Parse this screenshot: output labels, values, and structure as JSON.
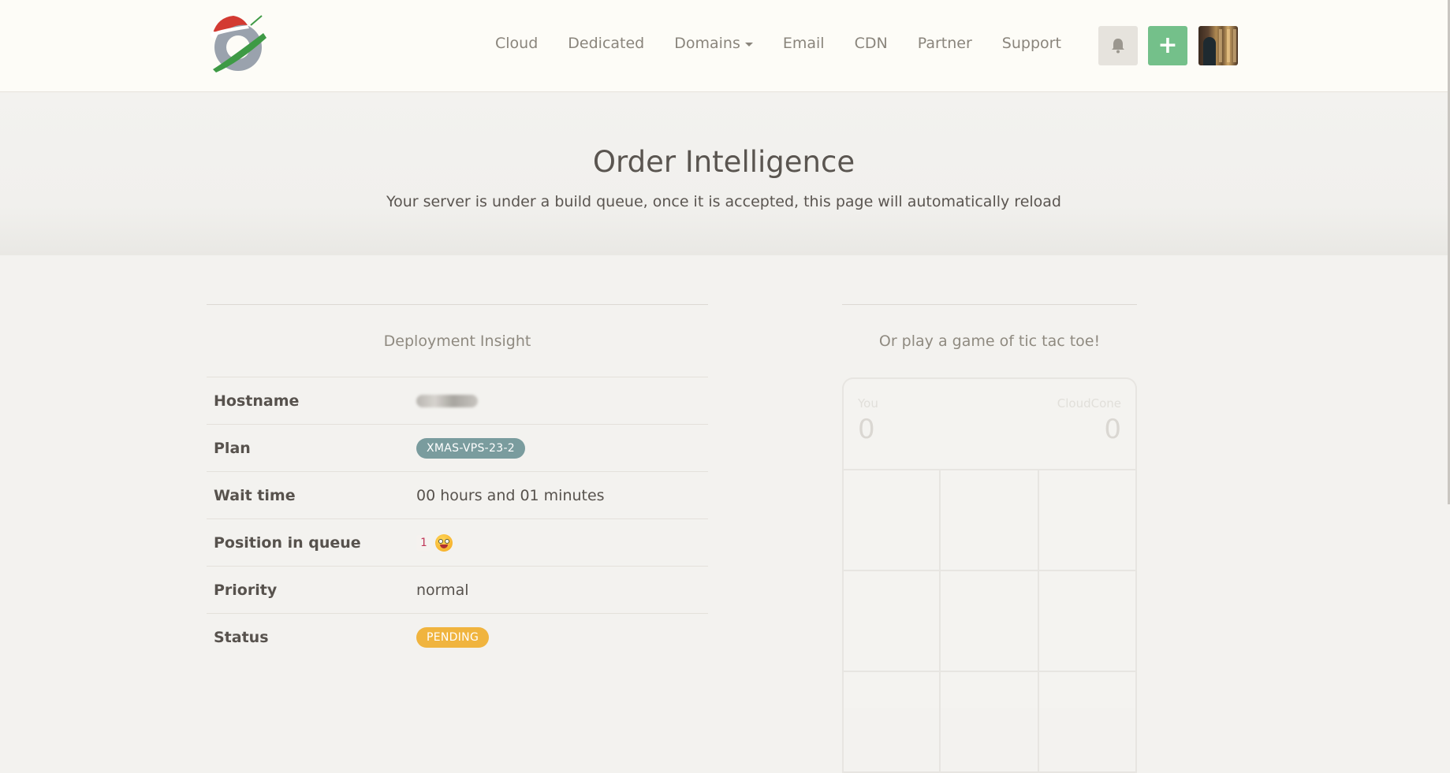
{
  "navbar": {
    "logo_icon": "cloudcone-logo-icon",
    "links": [
      {
        "label": "Cloud"
      },
      {
        "label": "Dedicated"
      },
      {
        "label": "Domains",
        "dropdown": true
      },
      {
        "label": "Email"
      },
      {
        "label": "CDN"
      },
      {
        "label": "Partner"
      },
      {
        "label": "Support"
      }
    ],
    "bell_icon": "bell-icon",
    "add_label": "+",
    "add_color": "#74c08a"
  },
  "hero": {
    "title": "Order Intelligence",
    "subtitle": "Your server is under a build queue, once it is accepted, this page will automatically reload"
  },
  "insight": {
    "heading": "Deployment Insight",
    "rows": {
      "hostname": {
        "label": "Hostname"
      },
      "plan": {
        "label": "Plan",
        "value": "XMAS-VPS-23-2"
      },
      "wait": {
        "label": "Wait time",
        "value": "00 hours and 01 minutes"
      },
      "position": {
        "label": "Position in queue",
        "value": "1",
        "icon": "grinning-face-emoji-icon"
      },
      "priority": {
        "label": "Priority",
        "value": "normal"
      },
      "status": {
        "label": "Status",
        "value": "PENDING",
        "color": "#f0b43e"
      }
    }
  },
  "game": {
    "heading": "Or play a game of tic tac toe!",
    "player_label": "You",
    "player_score": "0",
    "opponent_label": "CloudCone",
    "opponent_score": "0"
  }
}
